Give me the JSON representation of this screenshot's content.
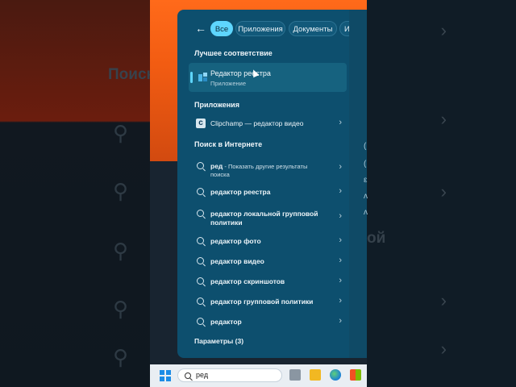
{
  "background": {
    "left_label": "Поиск",
    "right_label": "ой"
  },
  "filters": {
    "back_icon": "arrow-left-icon",
    "tabs": [
      {
        "label": "Все",
        "active": true
      },
      {
        "label": "Приложения",
        "active": false
      },
      {
        "label": "Документы",
        "active": false
      },
      {
        "label": "Интерн",
        "active": false
      }
    ]
  },
  "best_match": {
    "header": "Лучшее соответствие",
    "title": "Редактор реестра",
    "subtitle": "Приложение",
    "icon": "registry-editor-icon"
  },
  "apps": {
    "header": "Приложения",
    "items": [
      {
        "label": "Clipchamp — редактор видео",
        "icon": "clipchamp-icon"
      }
    ]
  },
  "web": {
    "header": "Поиск в Интернете",
    "first": {
      "term": "ред",
      "hint": " - Показать другие результаты",
      "hint2": "поиска"
    },
    "items": [
      {
        "label": "редактор реестра"
      },
      {
        "label": "редактор локальной групповой",
        "label2": "политики"
      },
      {
        "label": "редактор фото"
      },
      {
        "label": "редактор видео"
      },
      {
        "label": "редактор скриншотов"
      },
      {
        "label": "редактор групповой политики"
      },
      {
        "label": "редактор"
      }
    ]
  },
  "settings": {
    "label": "Параметры (3)"
  },
  "taskbar": {
    "search_query": "ред",
    "apps": [
      "task-view-icon",
      "file-explorer-icon",
      "edge-icon",
      "store-icon"
    ]
  },
  "colors": {
    "panel": "#0d4f6e",
    "accent": "#5ed6ff",
    "taskbar": "#e9eef3"
  }
}
